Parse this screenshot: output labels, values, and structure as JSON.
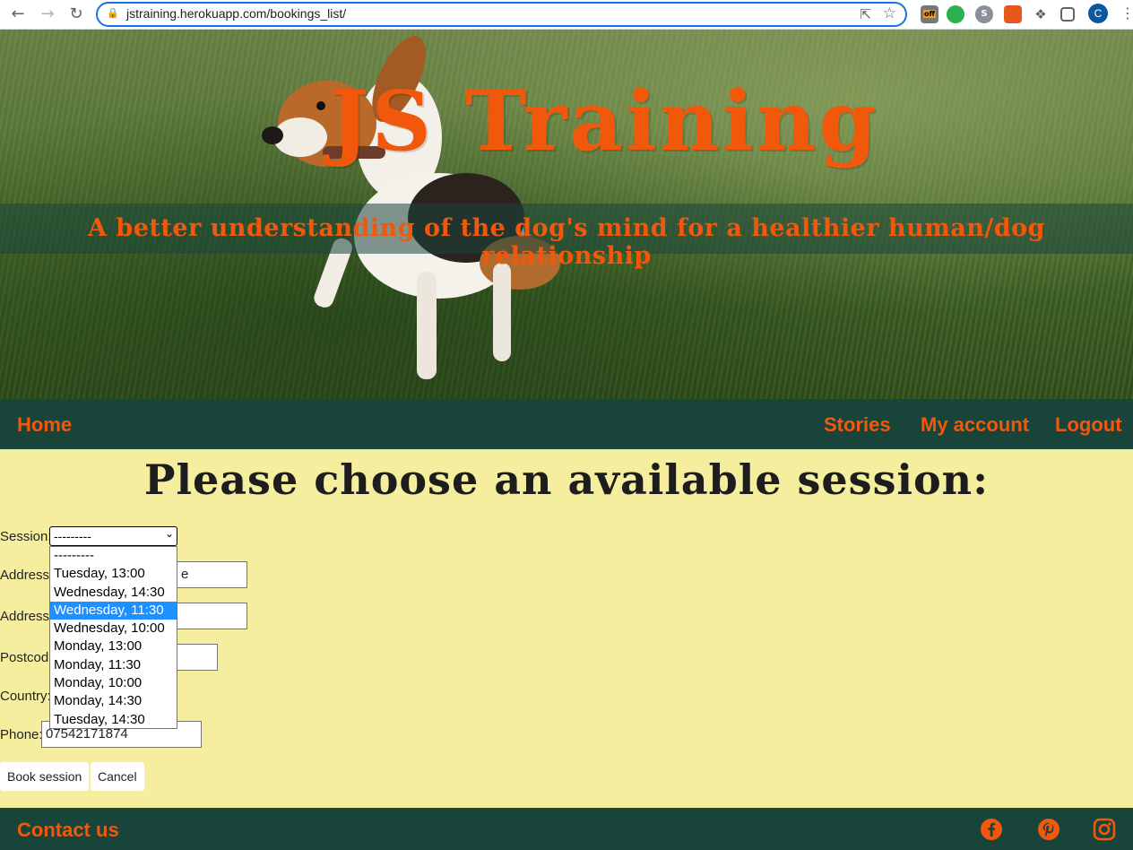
{
  "browser": {
    "url": "jstraining.herokuapp.com/bookings_list/",
    "profile_initial": "C",
    "ext_off_label": "off"
  },
  "hero": {
    "title": "JS Training",
    "tagline": "A better understanding of the dog's mind for a healthier human/dog relationship"
  },
  "nav": {
    "home": "Home",
    "stories": "Stories",
    "account": "My account",
    "logout": "Logout"
  },
  "main": {
    "heading": "Please choose an available session:",
    "session_label": "Session:",
    "session_selected": "---------",
    "session_options": [
      "---------",
      "Tuesday, 13:00",
      "Wednesday, 14:30",
      "Wednesday, 11:30",
      "Wednesday, 10:00",
      "Monday, 13:00",
      "Monday, 11:30",
      "Monday, 10:00",
      "Monday, 14:30",
      "Tuesday, 14:30"
    ],
    "highlighted_option": "Wednesday, 11:30",
    "address1_label": "Address",
    "address2_label": "Address",
    "postcode_label": "Postcode",
    "country_label": "Country:",
    "phone_label": "Phone:",
    "phone_value": "07542171874",
    "address1_value_visible": "e",
    "book_button": "Book session",
    "cancel_button": "Cancel"
  },
  "footer": {
    "contact": "Contact us",
    "icons": [
      "facebook-icon",
      "pinterest-icon",
      "instagram-icon"
    ]
  },
  "colors": {
    "accent": "#f2580c",
    "nav_bg": "#19443a",
    "page_bg": "#f5ee9e",
    "highlight": "#1e90ff"
  }
}
